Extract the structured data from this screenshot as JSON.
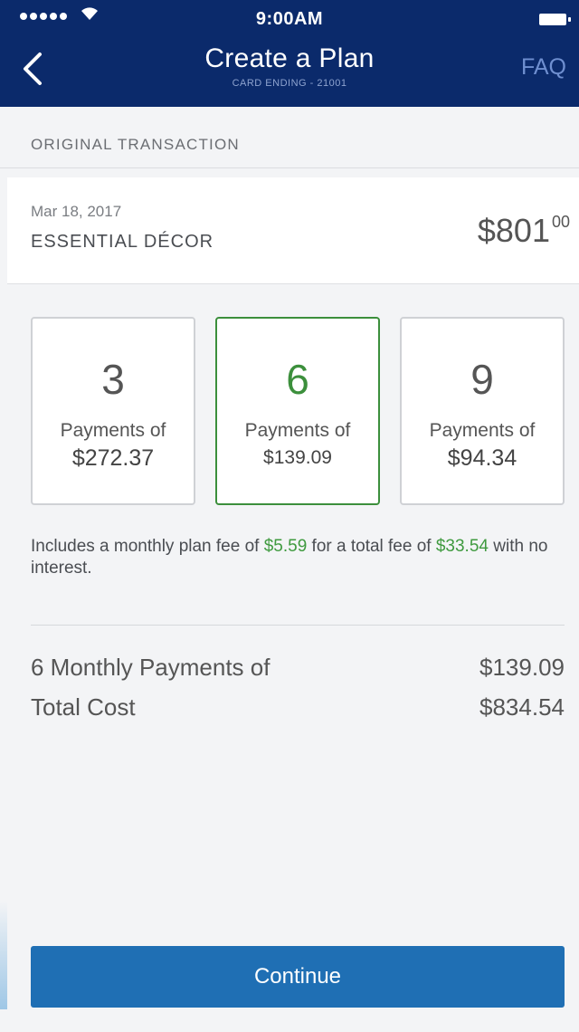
{
  "status": {
    "time": "9:00AM"
  },
  "nav": {
    "title": "Create a Plan",
    "subtitle": "CARD ENDING - 21001",
    "faq": "FAQ"
  },
  "section": {
    "label": "ORIGINAL TRANSACTION"
  },
  "transaction": {
    "date": "Mar 18, 2017",
    "merchant": "ESSENTIAL DÉCOR",
    "amount_main": "$801",
    "amount_cents": "00"
  },
  "plans": [
    {
      "count": "3",
      "label": "Payments of",
      "price": "$272.37",
      "selected": false
    },
    {
      "count": "6",
      "label": "Payments of",
      "price": "$139.09",
      "selected": true
    },
    {
      "count": "9",
      "label": "Payments of",
      "price": "$94.34",
      "selected": false
    }
  ],
  "fee_note": {
    "part1": "Includes a monthly plan fee of ",
    "monthly_fee": "$5.59",
    "part2": " for a total fee of ",
    "total_fee": "$33.54",
    "part3": " with no interest."
  },
  "summary": {
    "monthly_label": "6 Monthly Payments of",
    "monthly_value": "$139.09",
    "total_label": "Total Cost",
    "total_value": "$834.54"
  },
  "continue_label": "Continue",
  "colors": {
    "header_bg": "#0b2a6b",
    "accent_green": "#3f9a3f",
    "button_blue": "#1f6fb4",
    "faq_blue": "#6f8fd0"
  }
}
